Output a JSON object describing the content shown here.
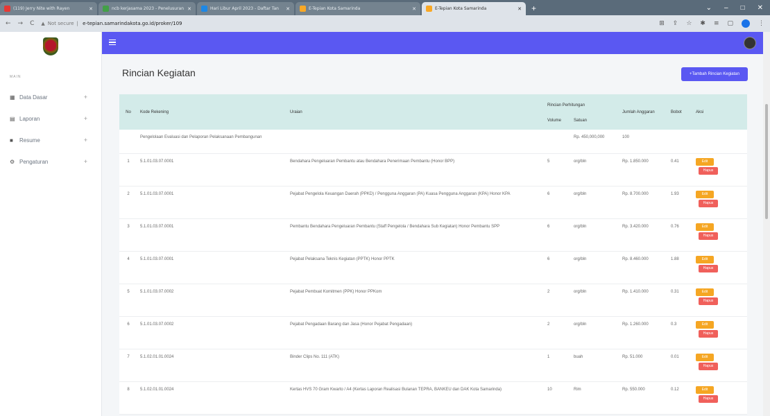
{
  "browser": {
    "tabs": [
      {
        "title": "(119) Jerry Nite with Rayen",
        "color": "#e53935"
      },
      {
        "title": "ncb kerjasama 2023 - Penelusuran",
        "color": "#43a047"
      },
      {
        "title": "Hari Libur April 2023 - Daftar Tan",
        "color": "#1e88e5"
      },
      {
        "title": "E-Tepian Kota Samarinda",
        "color": "#f9a825"
      },
      {
        "title": "E-Tepian Kota Samarinda",
        "color": "#f9a825"
      }
    ],
    "new_tab": "+",
    "url_prefix": "Not secure",
    "url": "e-tepian.samarindakota.go.id/proker/109"
  },
  "sidebar": {
    "section": "MAIN",
    "items": [
      {
        "label": "Data Dasar",
        "icon": "grid-icon"
      },
      {
        "label": "Laporan",
        "icon": "document-icon"
      },
      {
        "label": "Resume",
        "icon": "list-icon"
      },
      {
        "label": "Pengaturan",
        "icon": "gear-icon"
      }
    ]
  },
  "page": {
    "title": "Rincian Kegiatan",
    "add_button": "+Tambah Rincian Kegiatan"
  },
  "table": {
    "headers": {
      "no": "No",
      "kode": "Kode Rekening",
      "uraian": "Uraian",
      "rincian": "Rincian Perhitungan",
      "volume": "Volume",
      "satuan": "Satuan",
      "jumlah": "Jumlah Anggaran",
      "bobot": "Bobot",
      "aksi": "Aksi"
    },
    "edit_label": "Edit",
    "delete_label": "Hapus",
    "group_row": {
      "kode": "Pengelolaan Evaluasi dan Pelaporan Pelaksanaan Pembangunan",
      "satuan": "Rp. 450,000,000",
      "jumlah": "100"
    },
    "rows": [
      {
        "no": "1",
        "kode": "5.1.01.03.07.0001",
        "uraian": "Bendahara Pengeluaran Pembantu atau Bendahara Penerimaan Pembantu (Honor BPP)",
        "volume": "5",
        "satuan": "org/bln",
        "jumlah": "Rp. 1.850.000",
        "bobot": "0.41"
      },
      {
        "no": "2",
        "kode": "5.1.01.03.07.0001",
        "uraian": "Pejabat Pengelola Keuangan Daerah (PPKD) / Pengguna Anggaran (PA) Kuasa Pengguna Anggaran (KPA) Honor KPA",
        "volume": "6",
        "satuan": "org/bln",
        "jumlah": "Rp. 8.700.000",
        "bobot": "1.93"
      },
      {
        "no": "3",
        "kode": "5.1.01.03.07.0001",
        "uraian": "Pembantu Bendahara Pengeluaran Pembantu (Staff Pengelola / Bendahara Sub Kegiatan) Honor Pembantu SPP",
        "volume": "6",
        "satuan": "org/bln",
        "jumlah": "Rp. 3.420.000",
        "bobot": "0.76"
      },
      {
        "no": "4",
        "kode": "5.1.01.03.07.0001",
        "uraian": "Pejabat Pelaksana Teknis Kegiatan (PPTK) Honor PPTK",
        "volume": "6",
        "satuan": "org/bln",
        "jumlah": "Rp. 8.460.000",
        "bobot": "1.88"
      },
      {
        "no": "5",
        "kode": "5.1.01.03.07.0002",
        "uraian": "Pejabat Pembuat Komitmen (PPK) Honor PPKom",
        "volume": "2",
        "satuan": "org/bln",
        "jumlah": "Rp. 1.410.000",
        "bobot": "0.31"
      },
      {
        "no": "6",
        "kode": "5.1.01.03.07.0002",
        "uraian": "Pejabat Pengadaan Barang dan Jasa (Honor Pejabat Pengadaan)",
        "volume": "2",
        "satuan": "org/bln",
        "jumlah": "Rp. 1.260.000",
        "bobot": "0.3"
      },
      {
        "no": "7",
        "kode": "5.1.02.01.01.0024",
        "uraian": "Binder Clips No. 111 (ATK)",
        "volume": "1",
        "satuan": "buah",
        "jumlah": "Rp. 51.000",
        "bobot": "0.01"
      },
      {
        "no": "8",
        "kode": "5.1.02.01.01.0024",
        "uraian": "Kertas HVS 70 Gram Kwarto / A4 (Kertas Laporan Realisasi Bulanan TEPRA, BANKEU dan DAK Kota Samarinda)",
        "volume": "10",
        "satuan": "Rim",
        "jumlah": "Rp. 550.000",
        "bobot": "0.12"
      }
    ]
  }
}
